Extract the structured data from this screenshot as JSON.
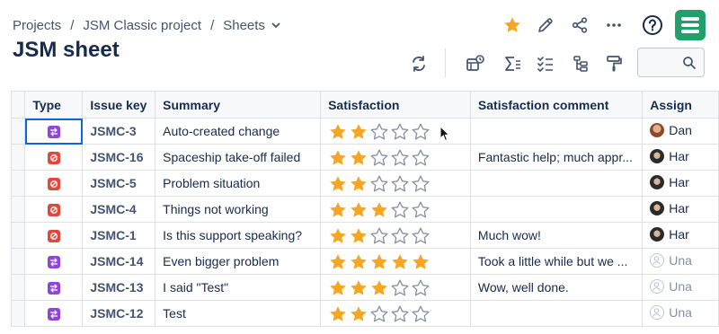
{
  "breadcrumb": {
    "items": [
      "Projects",
      "JSM Classic project",
      "Sheets"
    ],
    "separator": "/"
  },
  "page_title": "JSM sheet",
  "header_icons": [
    "star-icon",
    "edit-pencil-icon",
    "share-icon",
    "more-icon",
    "help-icon",
    "app-logo"
  ],
  "toolbar_icons": [
    "refresh-icon",
    "view-settings-icon",
    "sum-icon",
    "checklist-icon",
    "hierarchy-icon",
    "format-painter-icon"
  ],
  "search": {
    "value": "",
    "placeholder": ""
  },
  "colors": {
    "star_filled": "#f5a623",
    "star_empty": "#8590a2",
    "change_type": "#8f45d9",
    "incident_type": "#e2483d",
    "logo": "#22a06b",
    "selection": "#0c66e4"
  },
  "table": {
    "columns": [
      "Type",
      "Issue key",
      "Summary",
      "Satisfaction",
      "Satisfaction comment",
      "Assign"
    ],
    "rows": [
      {
        "type": "change",
        "key": "JSMC-3",
        "summary": "Auto-created change",
        "rating": 2,
        "comment": "",
        "assignee": "Dan",
        "avatar": "photo-a"
      },
      {
        "type": "incident",
        "key": "JSMC-16",
        "summary": "Spaceship take-off failed",
        "rating": 2,
        "comment": "Fantastic help; much appr...",
        "assignee": "Har",
        "avatar": "photo-b"
      },
      {
        "type": "incident",
        "key": "JSMC-5",
        "summary": "Problem situation",
        "rating": 2,
        "comment": "",
        "assignee": "Har",
        "avatar": "photo-b"
      },
      {
        "type": "incident",
        "key": "JSMC-4",
        "summary": "Things not working",
        "rating": 3,
        "comment": "",
        "assignee": "Har",
        "avatar": "photo-b"
      },
      {
        "type": "incident",
        "key": "JSMC-1",
        "summary": "Is this support speaking?",
        "rating": 2,
        "comment": "Much wow!",
        "assignee": "Har",
        "avatar": "photo-b"
      },
      {
        "type": "change",
        "key": "JSMC-14",
        "summary": "Even bigger problem",
        "rating": 5,
        "comment": "Took a little while but we ...",
        "assignee": "Una",
        "avatar": "unassigned"
      },
      {
        "type": "change",
        "key": "JSMC-13",
        "summary": "I said \"Test\"",
        "rating": 3,
        "comment": "Wow, well done.",
        "assignee": "Una",
        "avatar": "unassigned"
      },
      {
        "type": "change",
        "key": "JSMC-12",
        "summary": "Test",
        "rating": 2,
        "comment": "",
        "assignee": "Una",
        "avatar": "unassigned"
      }
    ]
  }
}
